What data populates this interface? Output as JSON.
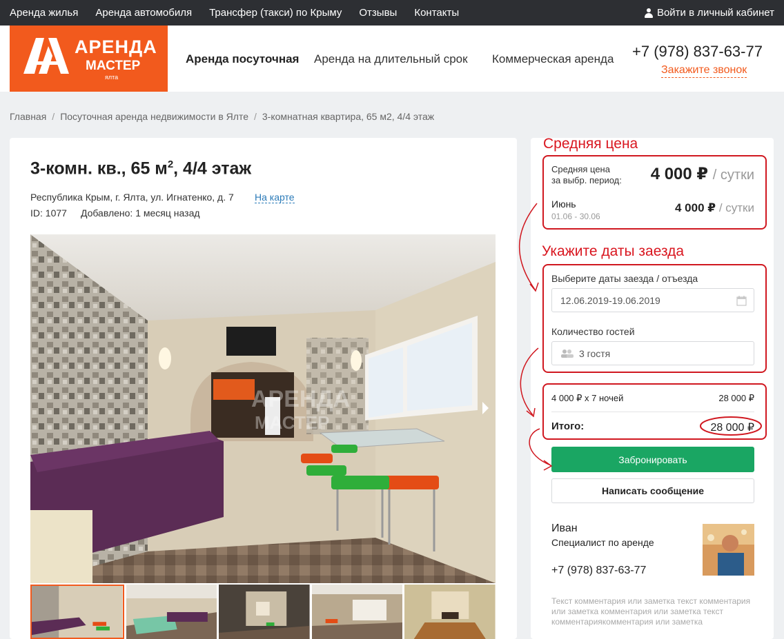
{
  "topbar": {
    "nav": [
      "Аренда жилья",
      "Аренда автомобиля",
      "Трансфер (такси) по Крыму",
      "Отзывы",
      "Контакты"
    ],
    "login": "Войти в личный кабинет"
  },
  "logo": {
    "line1": "АРЕНДА",
    "line2": "МАСТЕР",
    "line3": "ялта"
  },
  "mainnav": [
    "Аренда посуточная",
    "Аренда на длительный срок",
    "Коммерческая аренда"
  ],
  "contact": {
    "phone": "+7 (978) 837-63-77",
    "callback": "Закажите звонок"
  },
  "breadcrumb": [
    "Главная",
    "Посуточная аренда недвижимости в Ялте",
    "3-комнатная квартира, 65 м2, 4/4 этаж"
  ],
  "listing": {
    "title_main": "3-комн. кв., 65 м",
    "title_sup": "2",
    "title_end": ", 4/4 этаж",
    "address": "Республика Крым, г. Ялта, ул. Игнатенко, д. 7",
    "map_link": "На карте",
    "id": "ID: 1077",
    "added": "Добавлено: 1 месяц назад",
    "watermark1": "АРЕНДА",
    "watermark2": "МАСТЕР"
  },
  "annotations": {
    "avg_price": "Средняя цена",
    "dates": "Укажите даты заезда"
  },
  "price": {
    "avg_label_1": "Средняя цена",
    "avg_label_2": "за выбр. период:",
    "avg_value": "4 000 ₽",
    "avg_unit": "/ сутки",
    "month": "Июнь",
    "month_range": "01.06 - 30.06",
    "month_value": "4 000 ₽",
    "month_unit": "/ сутки"
  },
  "booking": {
    "dates_label": "Выберите даты заезда / отъезда",
    "dates_value": "12.06.2019-19.06.2019",
    "guests_label": "Количество гостей",
    "guests_value": "3 гостя",
    "calc_label": "4 000 ₽ x 7 ночей",
    "calc_value": "28 000 ₽",
    "total_label": "Итого:",
    "total_value": "28 000 ₽",
    "book_button": "Забронировать",
    "message_button": "Написать сообщение"
  },
  "agent": {
    "name": "Иван",
    "role": "Специалист по аренде",
    "phone": "+7 (978) 837-63-77",
    "note": "Текст комментария или заметка текст комментария или заметка комментария или заметка текст комментариякомментария или заметка"
  }
}
